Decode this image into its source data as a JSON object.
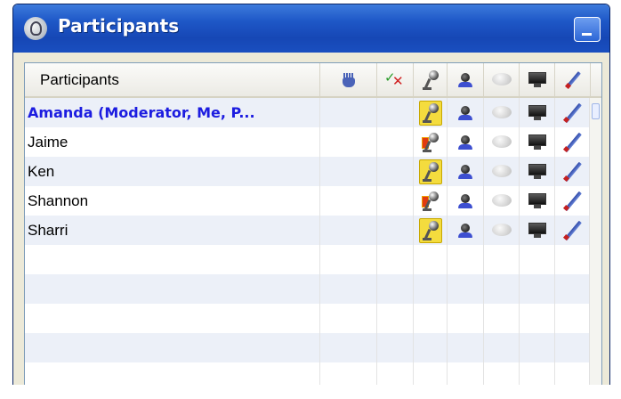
{
  "window": {
    "title": "Participants",
    "app_icon": "conference-app-icon",
    "minimize_icon": "minimize-icon"
  },
  "table": {
    "header": {
      "name_label": "Participants",
      "columns": [
        {
          "icon": "raise-hand-icon"
        },
        {
          "icon": "approve-deny-icon"
        },
        {
          "icon": "microphone-icon"
        },
        {
          "icon": "webcam-icon"
        },
        {
          "icon": "chat-icon"
        },
        {
          "icon": "screen-share-icon"
        },
        {
          "icon": "annotate-pen-icon"
        }
      ]
    },
    "rows": [
      {
        "name": "Amanda (Moderator, Me, P...",
        "is_me": true,
        "mic": "yellow"
      },
      {
        "name": "Jaime",
        "is_me": false,
        "mic": "red"
      },
      {
        "name": "Ken",
        "is_me": false,
        "mic": "yellow"
      },
      {
        "name": "Shannon",
        "is_me": false,
        "mic": "red"
      },
      {
        "name": "Sharri",
        "is_me": false,
        "mic": "yellow"
      }
    ],
    "empty_rows": 5
  },
  "colors": {
    "titlebar": "#1e57c7",
    "moderator_text": "#1c1ce0",
    "row_alt": "#ecf0f8",
    "mic_active_bg": "#f4dc3e"
  }
}
